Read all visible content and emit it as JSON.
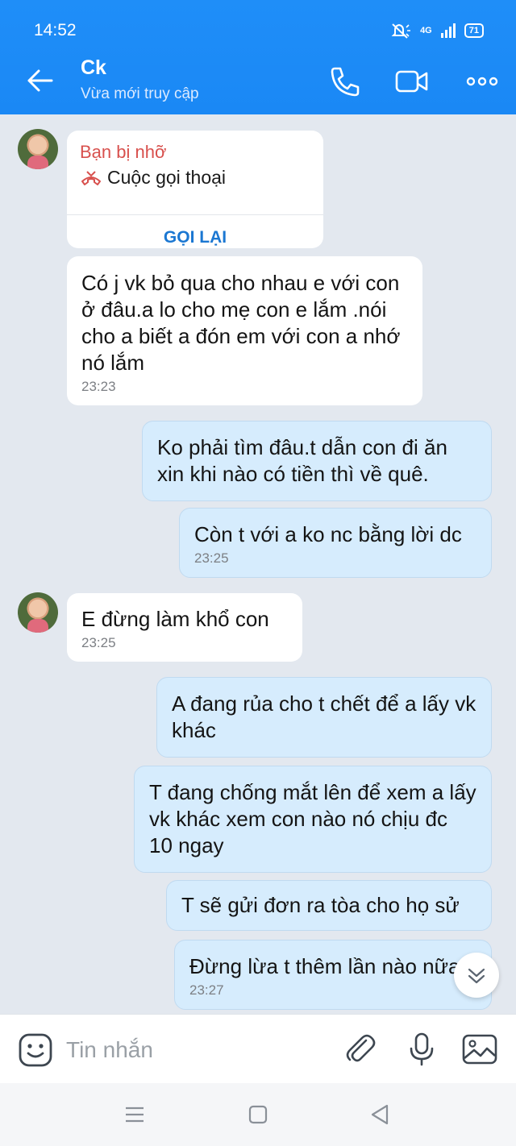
{
  "status_bar": {
    "time": "14:52",
    "network": "4G",
    "battery": "71"
  },
  "header": {
    "contact_name": "Ck",
    "contact_status": "Vừa mới truy cập"
  },
  "missed_call": {
    "title": "Bạn bị nhỡ",
    "subtitle": "Cuộc gọi thoại",
    "action": "GỌI LẠI"
  },
  "messages": [
    {
      "text": "Có j vk bỏ qua cho nhau e với con ở đâu.a lo cho mẹ con e lắm .nói cho a biết a đón em với con a nhớ nó lắm",
      "time": "23:23"
    },
    {
      "text": "Ko phải tìm đâu.t dẫn con đi ăn xin khi nào có tiền thì về quê.",
      "time": ""
    },
    {
      "text": "Còn t với a ko nc bằng lời dc",
      "time": "23:25"
    },
    {
      "text": "E đừng làm khổ con",
      "time": "23:25"
    },
    {
      "text": "A đang rủa cho t chết để a lấy vk khác",
      "time": ""
    },
    {
      "text": "T đang chống mắt lên để xem a lấy vk khác xem con nào nó chịu đc 10 ngay",
      "time": ""
    },
    {
      "text": "T sẽ gửi đơn ra tòa cho họ sử",
      "time": ""
    },
    {
      "text": "Đừng lừa t thêm lần nào nữa",
      "time": "23:27"
    }
  ],
  "composer": {
    "placeholder": "Tin nhắn"
  },
  "colors": {
    "header": "#1a88f5",
    "sent_bubble": "#d6ecfd",
    "received_bubble": "#ffffff",
    "missed_call": "#d8504d",
    "action": "#1b77d2"
  }
}
